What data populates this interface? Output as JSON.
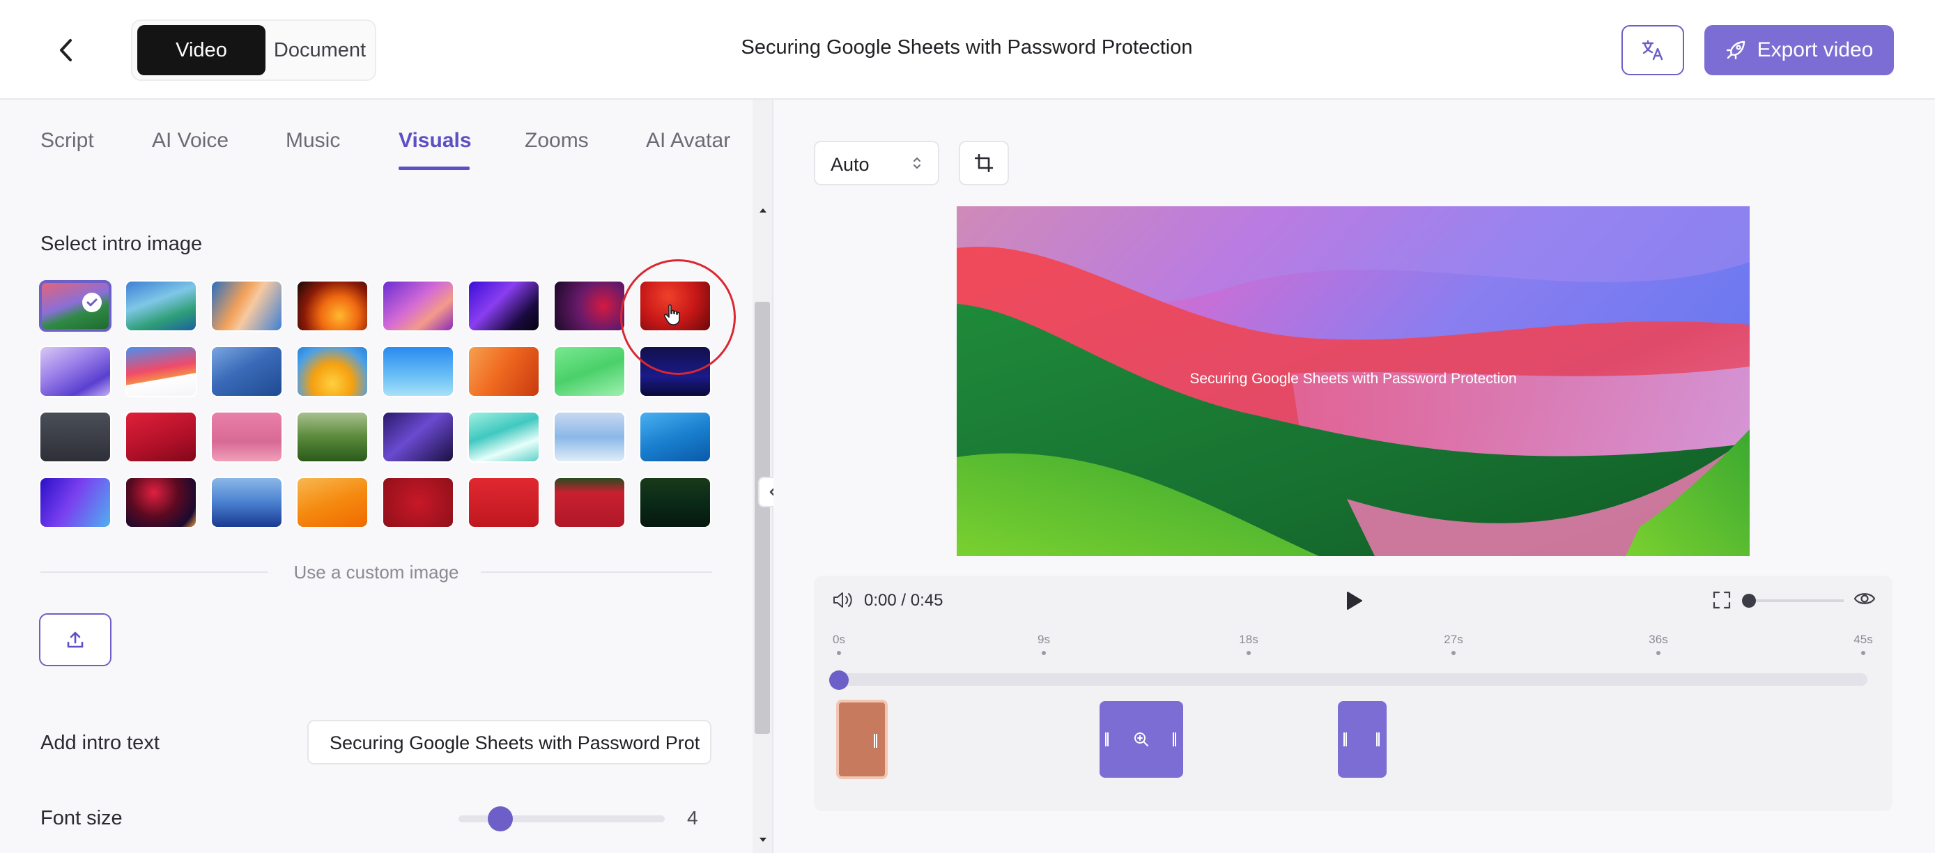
{
  "header": {
    "modes": [
      "Video",
      "Document"
    ],
    "active_mode": "Video",
    "title": "Securing Google Sheets with Password Protection",
    "export_label": "Export video",
    "icons": [
      "chevron-left-icon",
      "translate-icon",
      "rocket-icon"
    ]
  },
  "tabs": [
    {
      "label": "Script",
      "active": false
    },
    {
      "label": "AI Voice",
      "active": false
    },
    {
      "label": "Music",
      "active": false
    },
    {
      "label": "Visuals",
      "active": true
    },
    {
      "label": "Zooms",
      "active": false
    },
    {
      "label": "AI Avatar",
      "active": false
    }
  ],
  "visuals": {
    "select_intro_label": "Select intro image",
    "selected_index": 0,
    "hovered_index": 7,
    "custom_image_label": "Use a custom image",
    "add_intro_text_label": "Add intro text",
    "intro_text_value": "Securing Google Sheets with Password Prot",
    "font_size_label": "Font size",
    "font_size_value": "4"
  },
  "preview": {
    "aspect": "Auto",
    "overlay_text": "Securing Google Sheets with Password Protection"
  },
  "timeline": {
    "time": "0:00 / 0:45",
    "ticks": [
      "0s",
      "9s",
      "18s",
      "27s",
      "36s",
      "45s"
    ],
    "playhead_seconds": 0,
    "clips": [
      {
        "type": "intro",
        "color": "#c77a5e"
      },
      {
        "type": "zoom",
        "color": "#7b6dd3"
      },
      {
        "type": "segment",
        "color": "#7b6dd3"
      }
    ]
  },
  "colors": {
    "accent": "#6c5fc7",
    "export": "#7b6dd3",
    "hover_ring": "#d9272f"
  }
}
